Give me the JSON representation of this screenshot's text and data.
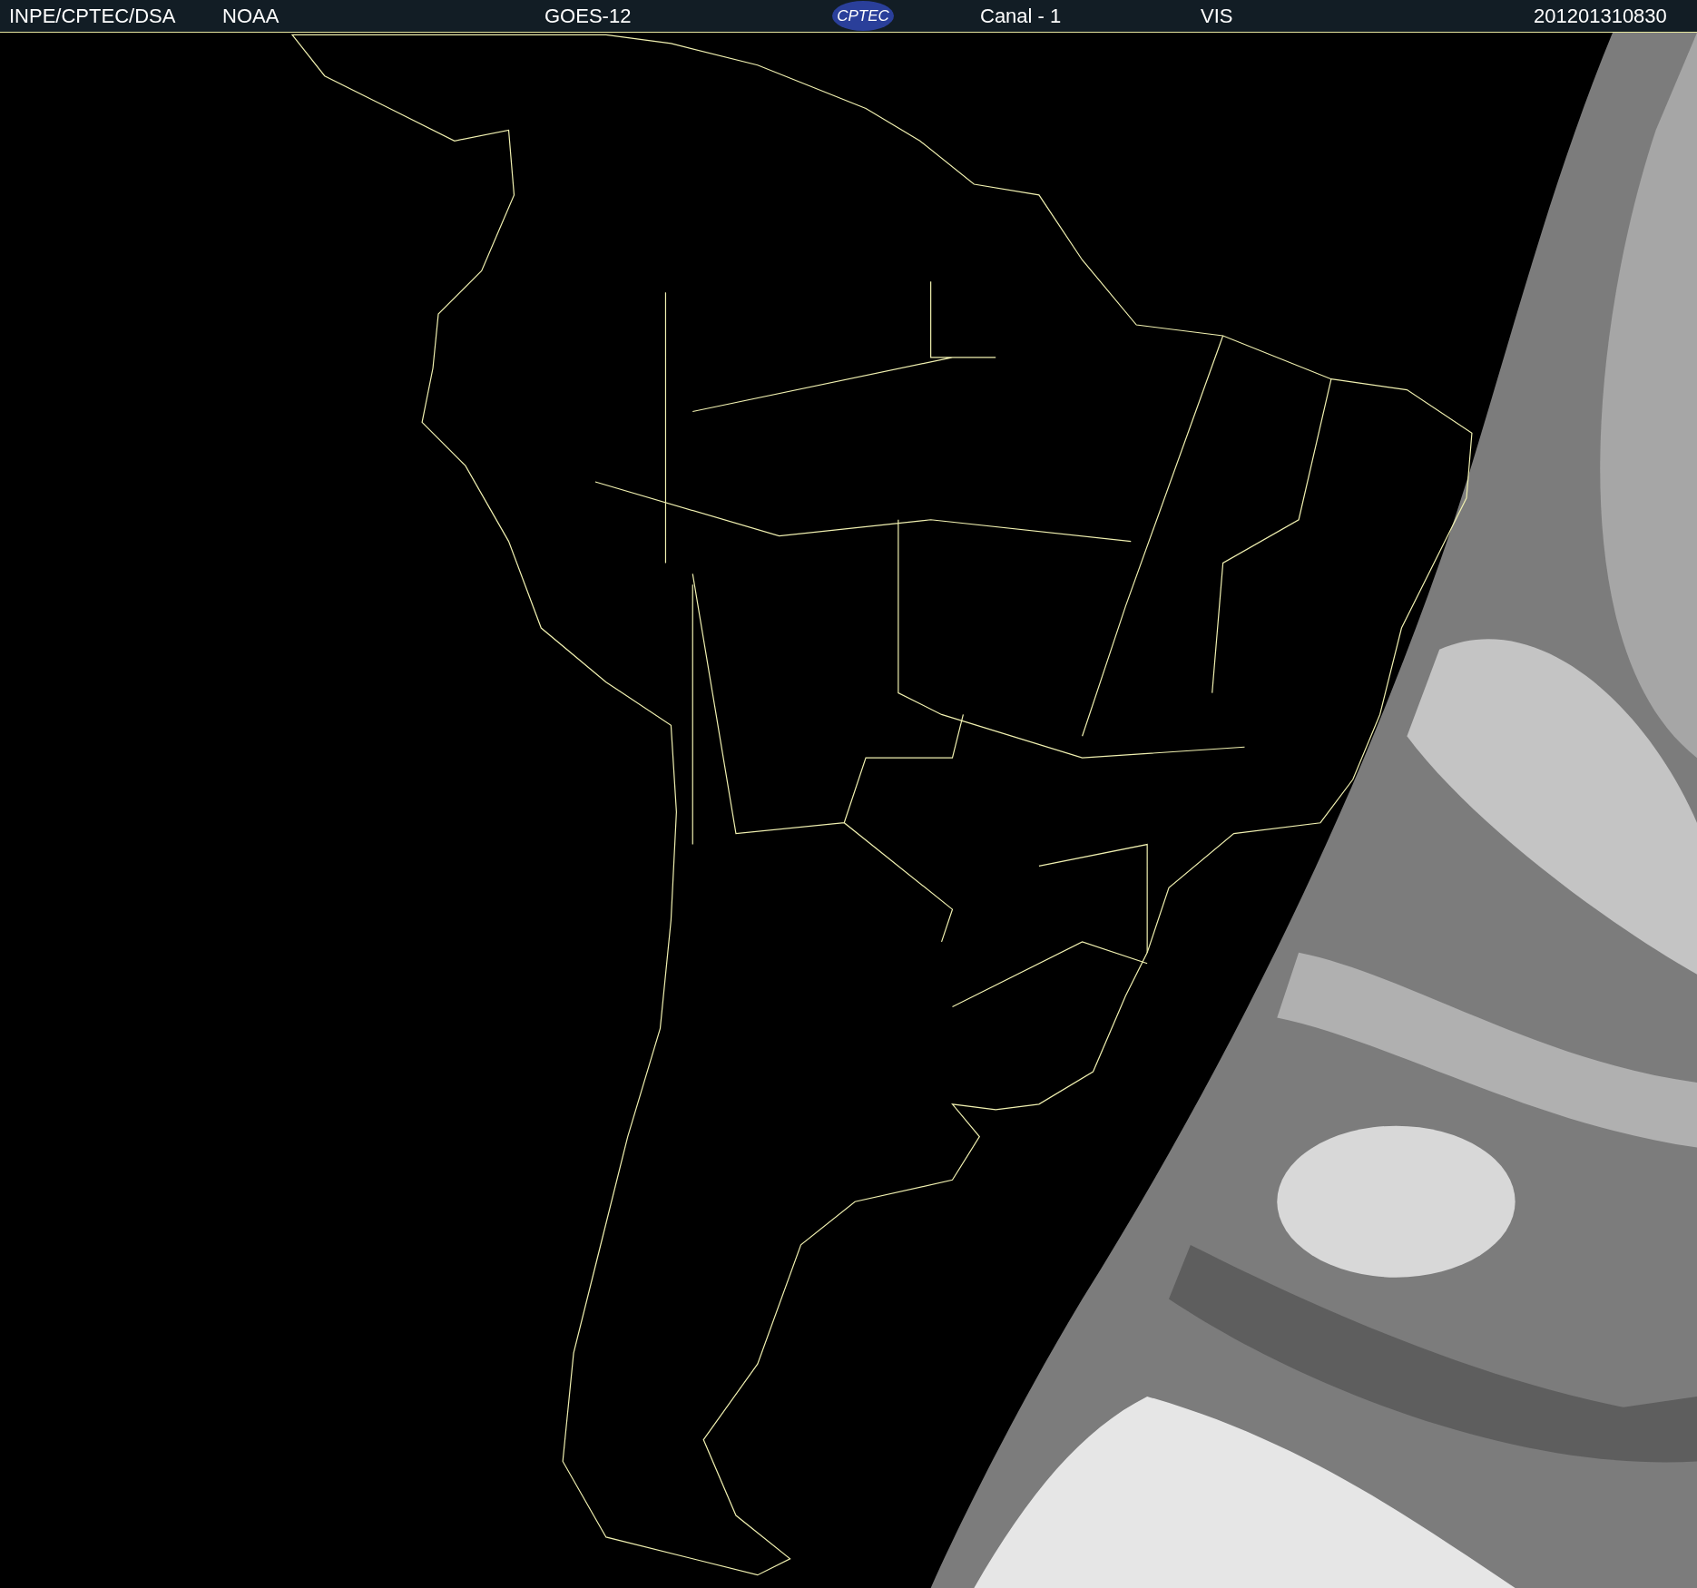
{
  "header": {
    "source": "INPE/CPTEC/DSA",
    "agency": "NOAA",
    "satellite": "GOES-12",
    "logo": "CPTEC",
    "channel": "Canal - 1",
    "band": "VIS",
    "timestamp": "201201310830"
  }
}
